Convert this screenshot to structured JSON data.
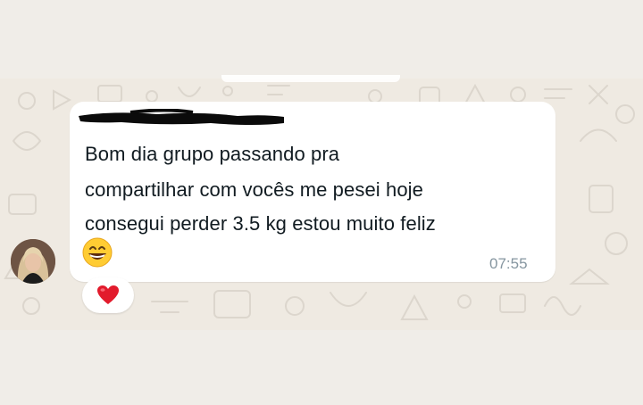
{
  "message": {
    "lines": [
      "Bom dia grupo passando pra",
      "compartilhar com vocês me pesei hoje",
      "consegui perder 3.5 kg estou muito feliz"
    ],
    "emoji": "grinning-face-emoji",
    "time": "07:55",
    "sender_name_redacted": true
  },
  "reaction": {
    "emoji": "red-heart-emoji"
  },
  "colors": {
    "chat_background": "#efeae2",
    "bubble": "#ffffff",
    "text": "#111b21",
    "time": "#8696a0",
    "heart": "#e21b2c"
  }
}
